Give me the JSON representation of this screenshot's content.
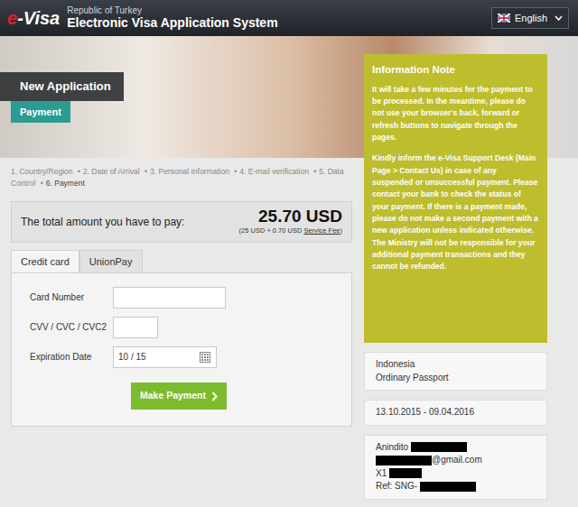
{
  "header": {
    "logo_e": "e",
    "logo_rest": "-Visa",
    "country": "Republic of Turkey",
    "system": "Electronic Visa Application System",
    "language": "English"
  },
  "hero": {
    "title": "New Application",
    "subtitle": "Payment"
  },
  "steps": {
    "separator": "•",
    "items": [
      {
        "label": "1. Country/Region",
        "selected": false
      },
      {
        "label": "2. Date of Arrival",
        "selected": false
      },
      {
        "label": "3. Personal Information",
        "selected": false
      },
      {
        "label": "4. E-mail verification",
        "selected": false
      },
      {
        "label": "5. Data Control",
        "selected": false
      },
      {
        "label": "6. Payment",
        "selected": true
      }
    ]
  },
  "amount": {
    "label": "The total amount you have to pay:",
    "value": "25.70 USD",
    "breakdown": "(25 USD + 0.70 USD",
    "fee_link": "Service Fee",
    "breakdown_end": ")"
  },
  "tabs": [
    {
      "label": "Credit card",
      "selected": true
    },
    {
      "label": "UnionPay",
      "selected": false
    }
  ],
  "form": {
    "fields": [
      {
        "label": "Card Number",
        "value": "",
        "kind": "text"
      },
      {
        "label": "CVV / CVC / CVC2",
        "value": "",
        "kind": "short"
      },
      {
        "label": "Expiration Date",
        "value": "10 / 15",
        "kind": "date"
      }
    ],
    "button": "Make Payment"
  },
  "note": {
    "title": "Information Note",
    "paragraphs": [
      "It will take a few minutes for the payment to be processed. In the meantime, please do not use your browser's back, forward or refresh buttons to navigate through the pages.",
      "Kindly inform the e-Visa Support Desk (Main Page > Contact Us) in case of any suspended or unsuccessful payment. Please contact your bank to check the status of your payment. If there is a payment made, please do not make a second payment with a new application unless indicated otherwise. The Ministry will not be responsible for your additional payment transactions and they cannot be refunded."
    ]
  },
  "summary": [
    {
      "lines": [
        {
          "text": "Indonesia",
          "redaction": "none"
        },
        {
          "text": "Ordinary Passport",
          "redaction": "none"
        }
      ]
    },
    {
      "lines": [
        {
          "text": "13.10.2015 - 09.04.2016",
          "redaction": "none"
        }
      ]
    },
    {
      "lines": [
        {
          "text": "Anindito",
          "redaction": "after"
        },
        {
          "text": "@gmail.com",
          "redaction": "before"
        },
        {
          "text": "X1",
          "redaction": "after"
        },
        {
          "text": "Ref: SNG-",
          "redaction": "after"
        }
      ]
    }
  ]
}
